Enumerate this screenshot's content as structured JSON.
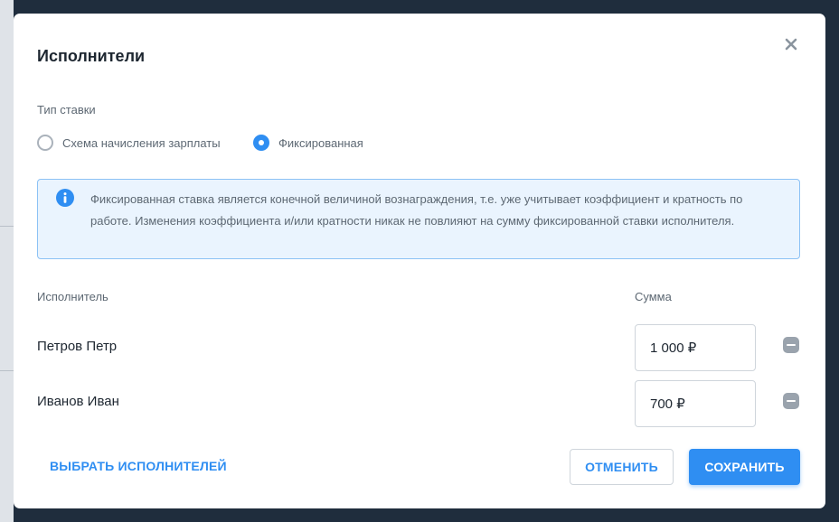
{
  "modal": {
    "title": "Исполнители",
    "close_icon": "close-icon"
  },
  "rate_type": {
    "label": "Тип ставки",
    "options": [
      {
        "label": "Схема начисления зарплаты",
        "selected": false
      },
      {
        "label": "Фиксированная",
        "selected": true
      }
    ]
  },
  "info": {
    "icon": "info-icon",
    "text": "Фиксированная ставка является конечной величиной вознаграждения, т.е. уже учитывает коэффициент и кратность по работе. Изменения коэффициента и/или кратности никак не повлияют на сумму фиксированной ставки исполнителя."
  },
  "table": {
    "headers": {
      "executor": "Исполнитель",
      "amount": "Сумма"
    },
    "rows": [
      {
        "name": "Петров Петр",
        "amount": "1 000 ₽"
      },
      {
        "name": "Иванов Иван",
        "amount": "700 ₽"
      }
    ]
  },
  "actions": {
    "select_executors": "ВЫБРАТЬ ИСПОЛНИТЕЛЕЙ",
    "cancel": "ОТМЕНИТЬ",
    "save": "СОХРАНИТЬ"
  },
  "colors": {
    "accent": "#2f8ef2",
    "backdrop": "#1f2d3d",
    "info_bg": "#eaf4fe",
    "info_border": "#8cc2f5"
  }
}
